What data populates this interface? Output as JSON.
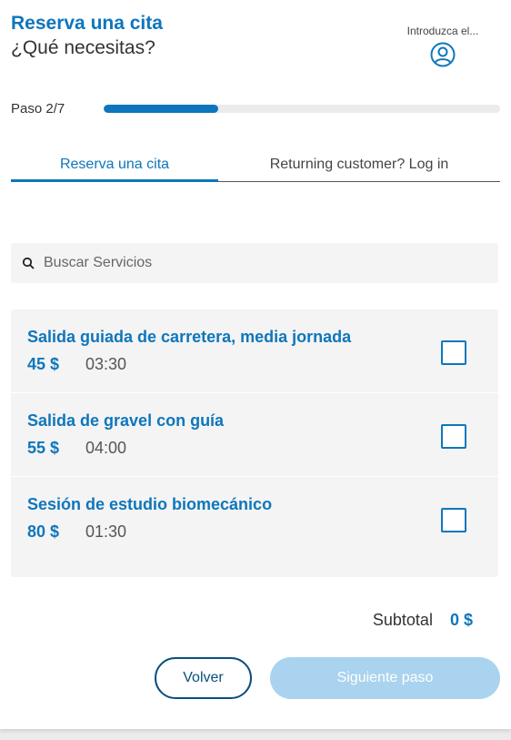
{
  "header": {
    "title": "Reserva una cita",
    "subtitle": "¿Qué necesitas?",
    "login_label": "Introduzca el...",
    "login_icon": "user-circle-icon"
  },
  "progress": {
    "label": "Paso 2/7",
    "current": 2,
    "total": 7,
    "fill_fraction": 0.29
  },
  "tabs": [
    {
      "label": "Reserva una cita",
      "active": true
    },
    {
      "label": "Returning customer? Log in",
      "active": false
    }
  ],
  "search": {
    "placeholder": "Buscar Servicios",
    "value": "",
    "icon": "search-icon"
  },
  "services": [
    {
      "name": "Salida guiada de carretera, media jornada",
      "price": "45 $",
      "duration": "03:30",
      "selected": false
    },
    {
      "name": "Salida de gravel con guía",
      "price": "55 $",
      "duration": "04:00",
      "selected": false
    },
    {
      "name": "Sesión de estudio biomecánico",
      "price": "80 $",
      "duration": "01:30",
      "selected": false
    }
  ],
  "subtotal": {
    "label": "Subtotal",
    "value": "0 $"
  },
  "buttons": {
    "back": "Volver",
    "next": "Siguiente paso"
  },
  "colors": {
    "accent": "#0e76bc",
    "progress_track": "#ebebeb",
    "panel_bg": "#f4f4f4",
    "next_disabled": "#a9d3ee",
    "back_border": "#0b4f7d"
  }
}
